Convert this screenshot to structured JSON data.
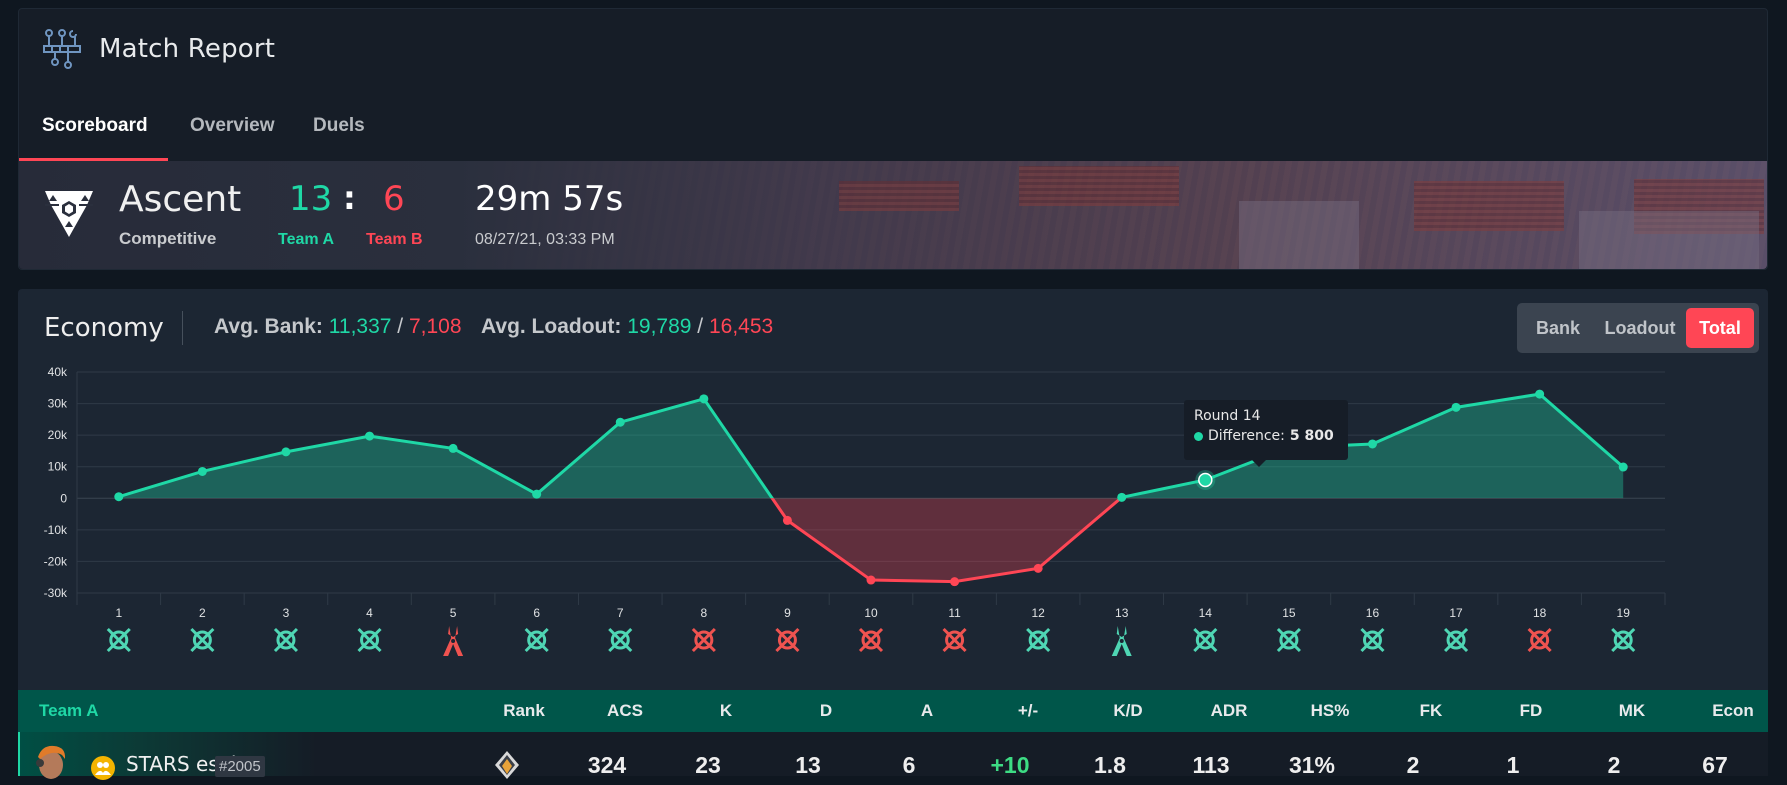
{
  "header": {
    "title": "Match Report",
    "icon": "circuit-icon"
  },
  "tabs": [
    {
      "label": "Scoreboard",
      "active": true
    },
    {
      "label": "Overview",
      "active": false
    },
    {
      "label": "Duels",
      "active": false
    }
  ],
  "match": {
    "map": "Ascent",
    "mode": "Competitive",
    "score_a": "13",
    "score_sep": ":",
    "score_b": "6",
    "team_a": "Team A",
    "team_b": "Team B",
    "duration": "29m 57s",
    "date": "08/27/21, 03:33 PM"
  },
  "economy": {
    "title": "Economy",
    "avg_bank_label": "Avg. Bank:",
    "avg_bank_a": "11,337",
    "avg_bank_b": "7,108",
    "avg_loadout_label": "Avg. Loadout:",
    "avg_loadout_a": "19,789",
    "avg_loadout_b": "16,453",
    "separator": "/",
    "modes": [
      {
        "label": "Bank",
        "active": false
      },
      {
        "label": "Loadout",
        "active": false
      },
      {
        "label": "Total",
        "active": true
      }
    ],
    "tooltip": {
      "title": "Round 14",
      "label": "Difference:",
      "value": "5 800"
    }
  },
  "colors": {
    "team_a": "#1fd8a6",
    "team_b": "#ff4655",
    "accent": "#ff4655"
  },
  "chart_data": {
    "type": "area",
    "title": "Economy",
    "xlabel": "Round",
    "ylabel": "Difference",
    "ylim": [
      -30000,
      40000
    ],
    "yticks": [
      40000,
      30000,
      20000,
      10000,
      0,
      -10000,
      -20000,
      -30000
    ],
    "ytick_labels": [
      "40k",
      "30k",
      "20k",
      "10k",
      "0",
      "-10k",
      "-20k",
      "-30k"
    ],
    "grid": true,
    "categories": [
      "1",
      "2",
      "3",
      "4",
      "5",
      "6",
      "7",
      "8",
      "9",
      "10",
      "11",
      "12",
      "13",
      "14",
      "15",
      "16",
      "17",
      "18",
      "19"
    ],
    "series": [
      {
        "name": "Difference",
        "values": [
          500,
          8500,
          14700,
          19700,
          15800,
          1300,
          24100,
          31500,
          -7000,
          -25900,
          -26400,
          -22200,
          300,
          5800,
          16000,
          17200,
          28800,
          33000,
          9900
        ]
      }
    ],
    "highlighted_round": 14,
    "round_outcomes": [
      {
        "round": 1,
        "winner": "A",
        "type": "elimination-icon"
      },
      {
        "round": 2,
        "winner": "A",
        "type": "elimination-icon"
      },
      {
        "round": 3,
        "winner": "A",
        "type": "elimination-icon"
      },
      {
        "round": 4,
        "winner": "A",
        "type": "elimination-icon"
      },
      {
        "round": 5,
        "winner": "B",
        "type": "defuse-icon"
      },
      {
        "round": 6,
        "winner": "A",
        "type": "elimination-icon"
      },
      {
        "round": 7,
        "winner": "A",
        "type": "elimination-icon"
      },
      {
        "round": 8,
        "winner": "B",
        "type": "elimination-icon"
      },
      {
        "round": 9,
        "winner": "B",
        "type": "elimination-icon"
      },
      {
        "round": 10,
        "winner": "B",
        "type": "elimination-icon"
      },
      {
        "round": 11,
        "winner": "B",
        "type": "elimination-icon"
      },
      {
        "round": 12,
        "winner": "A",
        "type": "elimination-icon"
      },
      {
        "round": 13,
        "winner": "A",
        "type": "defuse-icon"
      },
      {
        "round": 14,
        "winner": "A",
        "type": "elimination-icon"
      },
      {
        "round": 15,
        "winner": "A",
        "type": "elimination-icon"
      },
      {
        "round": 16,
        "winner": "A",
        "type": "elimination-icon"
      },
      {
        "round": 17,
        "winner": "A",
        "type": "elimination-icon"
      },
      {
        "round": 18,
        "winner": "B",
        "type": "elimination-icon"
      },
      {
        "round": 19,
        "winner": "A",
        "type": "elimination-icon"
      }
    ]
  },
  "scoreboard": {
    "team_label": "Team A",
    "columns": [
      "Rank",
      "ACS",
      "K",
      "D",
      "A",
      "+/-",
      "K/D",
      "ADR",
      "HS%",
      "FK",
      "FD",
      "MK",
      "Econ"
    ],
    "rows": [
      {
        "name": "STARS esahc",
        "tag": "#2005",
        "rank_icon": "rank-badge-icon",
        "values": [
          "324",
          "23",
          "13",
          "6",
          "+10",
          "1.8",
          "113",
          "31%",
          "2",
          "1",
          "2",
          "67"
        ]
      }
    ]
  }
}
